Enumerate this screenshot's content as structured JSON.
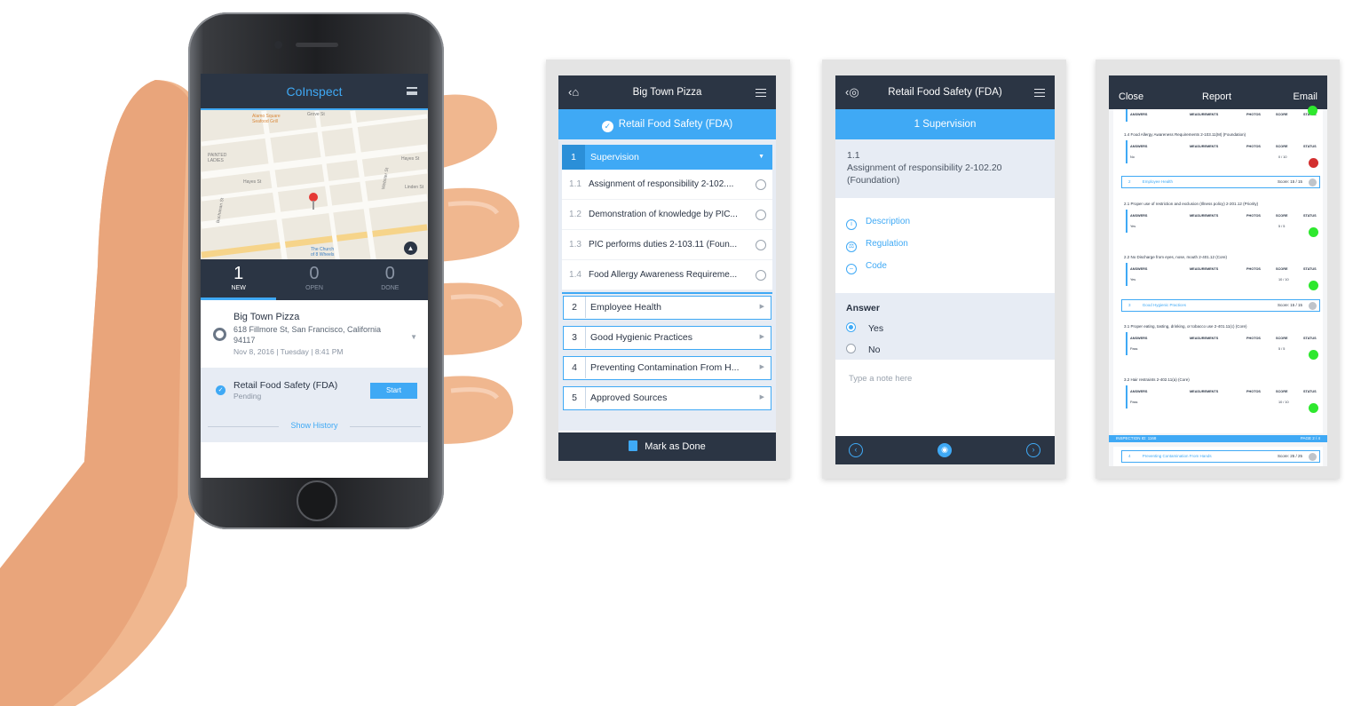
{
  "phone": {
    "logo": "CoInspect",
    "map_labels": {
      "alamo": "Alamo Square\nSeafood Grill",
      "painted": "PAINTED\nLADIES",
      "grove": "Grove St",
      "hayes1": "Hayes St",
      "hayes2": "Hayes St",
      "linden": "Linden St",
      "webster": "Webster St",
      "buchanan": "Buchanan St",
      "church": "The Church\nof 8 Wheels"
    },
    "tabs": [
      {
        "count": "1",
        "label": "NEW"
      },
      {
        "count": "0",
        "label": "OPEN"
      },
      {
        "count": "0",
        "label": "DONE"
      }
    ],
    "location": {
      "name": "Big Town Pizza",
      "address": "618 Fillmore St, San Francisco, California 94117",
      "date": "Nov 8, 2016 | Tuesday | 8:41 PM"
    },
    "inspection": {
      "name": "Retail Food Safety (FDA)",
      "status": "Pending",
      "start_label": "Start"
    },
    "show_history": "Show History"
  },
  "checklist": {
    "title": "Big Town Pizza",
    "subtitle": "Retail Food Safety (FDA)",
    "open_section": {
      "num": "1",
      "label": "Supervision"
    },
    "items": [
      {
        "num": "1.1",
        "label": "Assignment of responsibility 2-102...."
      },
      {
        "num": "1.2",
        "label": "Demonstration of knowledge by PIC..."
      },
      {
        "num": "1.3",
        "label": "PIC performs duties 2-103.11 (Foun..."
      },
      {
        "num": "1.4",
        "label": "Food Allergy Awareness Requireme..."
      }
    ],
    "sections": [
      {
        "num": "2",
        "label": "Employee Health"
      },
      {
        "num": "3",
        "label": "Good Hygienic Practices"
      },
      {
        "num": "4",
        "label": "Preventing Contamination From H..."
      },
      {
        "num": "5",
        "label": "Approved Sources"
      }
    ],
    "done_label": "Mark as Done"
  },
  "question": {
    "title": "Retail Food Safety (FDA)",
    "section": "1  Supervision",
    "num": "1.1",
    "text": "Assignment of responsibility 2-102.20 (Foundation)",
    "links": [
      "Description",
      "Regulation",
      "Code"
    ],
    "answer_title": "Answer",
    "options": [
      "Yes",
      "No"
    ],
    "note_placeholder": "Type a note here"
  },
  "report": {
    "close": "Close",
    "title": "Report",
    "email": "Email",
    "headers": [
      "ANSWERS",
      "MEASUREMENTS",
      "PHOTOS",
      "SCORE",
      "STATUS"
    ],
    "q14": {
      "label": "1.4  Food Allergy Awareness Requirements 2-103.11(M) (Foundation)",
      "answer": "No",
      "score": "0 / 10",
      "status_color": "#d32f2f"
    },
    "sec2": {
      "num": "2",
      "label": "Employee Health",
      "score": "Score: 15 / 15"
    },
    "q21": {
      "label": "2.1  Proper use of restriction and exclusion (Illness policy) 2-201.12 (Priority)",
      "answer": "Yes",
      "score": "5 / 5",
      "status_color": "#2ee82e"
    },
    "q22": {
      "label": "2.2  No Discharge from eyes, nose, mouth 2-401.12 (Core)",
      "answer": "Yes",
      "score": "10 / 10",
      "status_color": "#2ee82e"
    },
    "sec3": {
      "num": "3",
      "label": "Good Hygienic Practices",
      "score": "Score: 15 / 15"
    },
    "q31": {
      "label": "3.1  Proper eating, tasting, drinking, or tobacco use 2-401.11(c) (Core)",
      "answer": "Pass",
      "score": "5 / 5",
      "status_color": "#2ee82e"
    },
    "q32": {
      "label": "3.2  Hair restraints 2-402.11(a) (Core)",
      "answer": "Pass",
      "score": "10 / 10",
      "status_color": "#2ee82e"
    },
    "footer_left": "INSPECTION ID: 1168",
    "footer_right": "PAGE 2 / 4",
    "sec4": {
      "num": "4",
      "label": "Preventing Contamination From Hands",
      "score": "Score: 25 / 25"
    }
  },
  "colors": {
    "accent": "#3fa9f5",
    "navy": "#2b3544",
    "fail": "#d32f2f",
    "pass": "#2ee82e"
  }
}
